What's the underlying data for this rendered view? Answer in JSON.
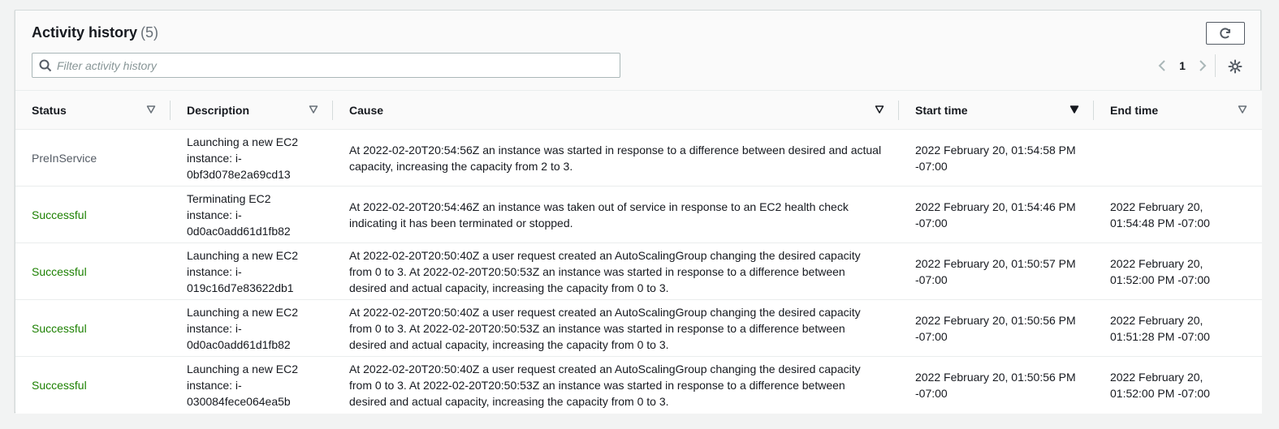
{
  "header": {
    "title": "Activity history",
    "count": "(5)",
    "search_placeholder": "Filter activity history",
    "page_number": "1"
  },
  "table": {
    "columns": [
      "Status",
      "Description",
      "Cause",
      "Start time",
      "End time"
    ],
    "rows": [
      {
        "status": "PreInService",
        "description": "Launching a new EC2 instance: i-0bf3d078e2a69cd13",
        "cause": "At 2022-02-20T20:54:56Z an instance was started in response to a difference between desired and actual capacity, increasing the capacity from 2 to 3.",
        "start": "2022 February 20, 01:54:58 PM -07:00",
        "end": ""
      },
      {
        "status": "Successful",
        "description": "Terminating EC2 instance: i-0d0ac0add61d1fb82",
        "cause": "At 2022-02-20T20:54:46Z an instance was taken out of service in response to an EC2 health check indicating it has been terminated or stopped.",
        "start": "2022 February 20, 01:54:46 PM -07:00",
        "end": "2022 February 20, 01:54:48 PM -07:00"
      },
      {
        "status": "Successful",
        "description": "Launching a new EC2 instance: i-019c16d7e83622db1",
        "cause": "At 2022-02-20T20:50:40Z a user request created an AutoScalingGroup changing the desired capacity from 0 to 3. At 2022-02-20T20:50:53Z an instance was started in response to a difference between desired and actual capacity, increasing the capacity from 0 to 3.",
        "start": "2022 February 20, 01:50:57 PM -07:00",
        "end": "2022 February 20, 01:52:00 PM -07:00"
      },
      {
        "status": "Successful",
        "description": "Launching a new EC2 instance: i-0d0ac0add61d1fb82",
        "cause": "At 2022-02-20T20:50:40Z a user request created an AutoScalingGroup changing the desired capacity from 0 to 3. At 2022-02-20T20:50:53Z an instance was started in response to a difference between desired and actual capacity, increasing the capacity from 0 to 3.",
        "start": "2022 February 20, 01:50:56 PM -07:00",
        "end": "2022 February 20, 01:51:28 PM -07:00"
      },
      {
        "status": "Successful",
        "description": "Launching a new EC2 instance: i-030084fece064ea5b",
        "cause": "At 2022-02-20T20:50:40Z a user request created an AutoScalingGroup changing the desired capacity from 0 to 3. At 2022-02-20T20:50:53Z an instance was started in response to a difference between desired and actual capacity, increasing the capacity from 0 to 3.",
        "start": "2022 February 20, 01:50:56 PM -07:00",
        "end": "2022 February 20, 01:52:00 PM -07:00"
      }
    ]
  },
  "icons": [
    "refresh-icon",
    "search-icon",
    "chevron-left-icon",
    "chevron-right-icon",
    "settings-gear-icon",
    "sort-icon"
  ],
  "colors": {
    "status_success": "#1d8102",
    "status_pending": "#545b64"
  }
}
